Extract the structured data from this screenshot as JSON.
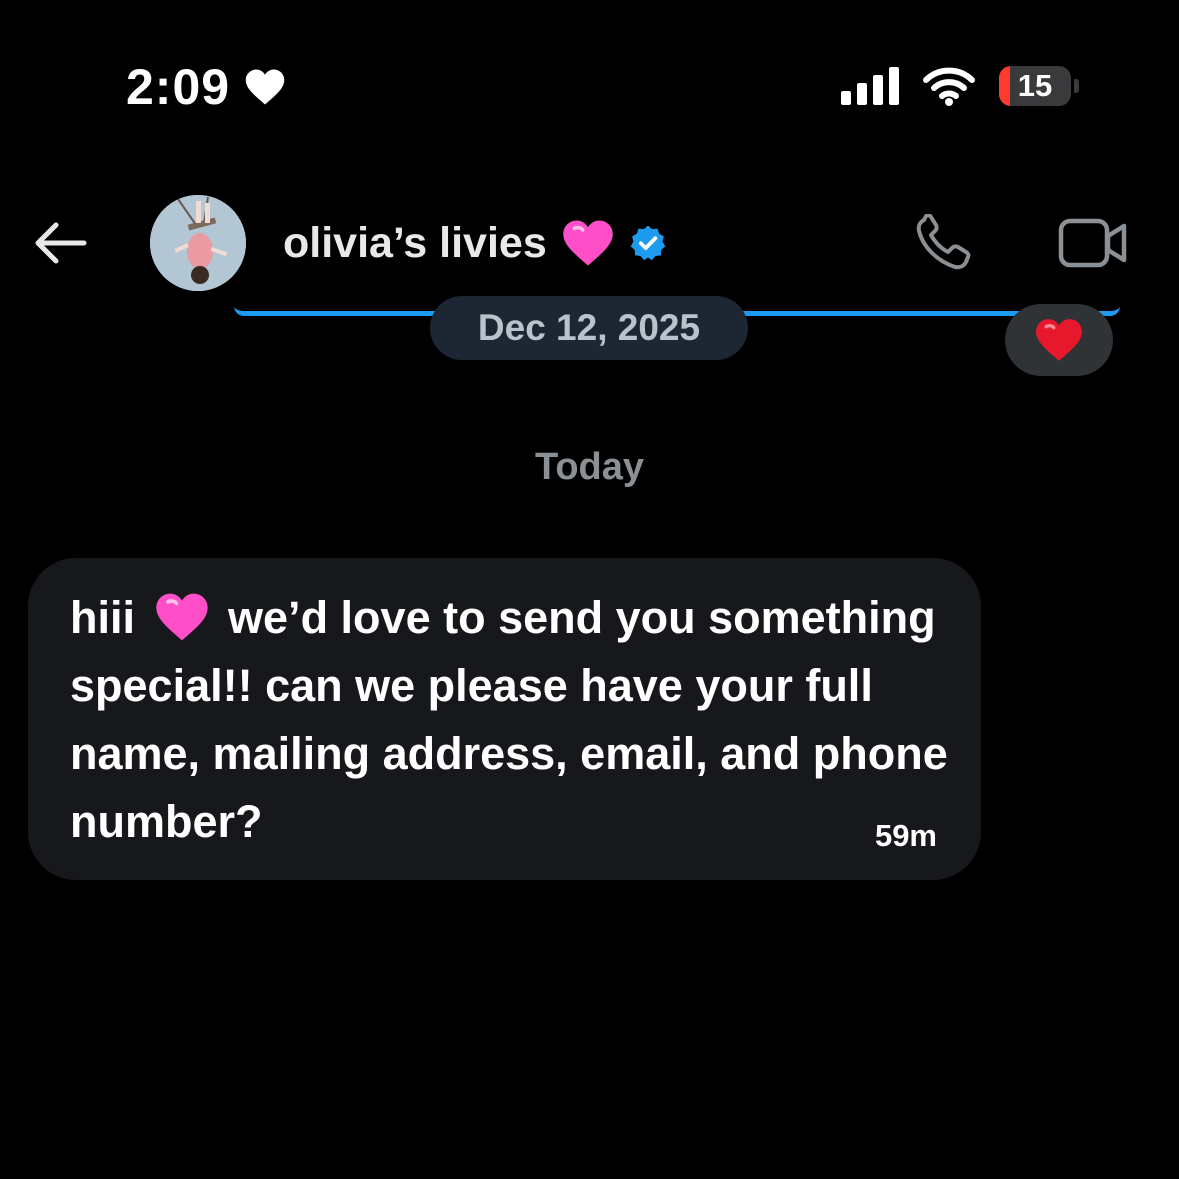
{
  "status_bar": {
    "time": "2:09",
    "status_icon": "heart-icon",
    "signal_icon": "cellular-signal-icon",
    "wifi_icon": "wifi-icon",
    "battery_level": "15",
    "battery_fraction": 0.15,
    "battery_color": "#ff3b30"
  },
  "header": {
    "back_icon": "arrow-left-icon",
    "contact_name": "olivia’s livies",
    "name_emoji": "pink-heart-emoji",
    "verified_icon": "verified-badge-icon",
    "verified_color": "#1d9bf0",
    "call_icon": "phone-icon",
    "video_icon": "video-camera-icon"
  },
  "conversation": {
    "previous_date": "Dec 12, 2025",
    "reaction_emoji": "red-heart-emoji",
    "day_label": "Today",
    "message": {
      "text_before_emoji": "hiii",
      "emoji": "pink-heart-emoji",
      "text_after_emoji": "we’d love to send you something special!! can we please have your full name, mailing address, email, and phone number?",
      "time": "59m"
    }
  },
  "colors": {
    "background": "#000000",
    "accent": "#1d9bf0",
    "bubble": "#16181c",
    "pink_heart": "#ff4fc8",
    "red_heart": "#e8182c"
  }
}
